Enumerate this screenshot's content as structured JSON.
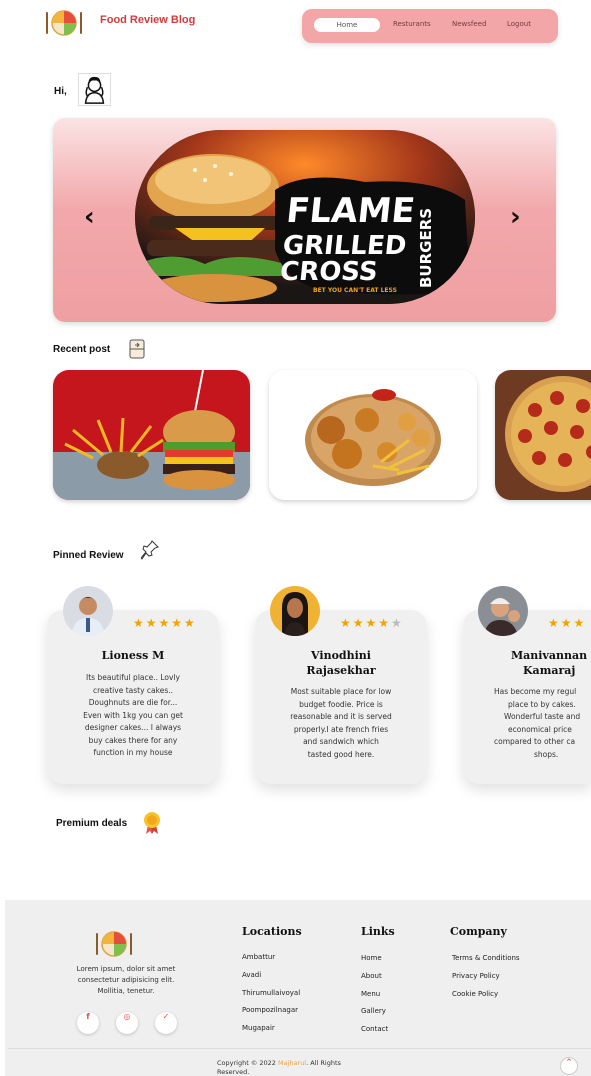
{
  "header": {
    "brand": "Food Review Blog",
    "nav": [
      {
        "label": "Home",
        "active": true
      },
      {
        "label": "Resturants"
      },
      {
        "label": "Newsfeed"
      },
      {
        "label": "Logout"
      }
    ]
  },
  "greeting": {
    "text": "Hi,"
  },
  "carousel": {
    "prev_icon": "chevron-left-icon",
    "next_icon": "chevron-right-icon",
    "slide": {
      "line1": "FLAME",
      "line2": "GRILLED",
      "line3": "CROSS",
      "vertical": "BURGERS",
      "tagline": "BET YOU CAN'T EAT LESS"
    }
  },
  "sections": {
    "recent_post": "Recent post",
    "pinned_review": "Pinned Review",
    "premium_deals": "Premium deals"
  },
  "reviews": [
    {
      "name": "Lioness M",
      "rating": 5,
      "text": [
        "Its beautiful place.. Lovly",
        "creative tasty cakes..",
        "Doughnuts are die for...",
        "Even with 1kg you can get",
        "designer cakes... I always",
        "buy cakes there for any",
        "function in my house"
      ]
    },
    {
      "name_lines": [
        "Vinodhini",
        "Rajasekhar"
      ],
      "rating": 4,
      "text": [
        "Most suitable place for low",
        "budget foodie. Price is",
        "reasonable and it is served",
        "properly.I ate french fries",
        "and sandwich which",
        "tasted good here."
      ]
    },
    {
      "name_lines": [
        "Manivannan",
        "Kamaraj"
      ],
      "rating": 3,
      "text": [
        "Has become my regul",
        "place to by cakes.",
        "Wonderful taste and",
        "economical price",
        "compared to other ca",
        "shops."
      ]
    }
  ],
  "footer": {
    "description": [
      "Lorem ipsum, dolor sit amet",
      "consectetur adipisicing elit.",
      "Mollitia, tenetur."
    ],
    "social": [
      {
        "icon": "facebook-icon",
        "glyph": "f"
      },
      {
        "icon": "instagram-icon",
        "glyph": "◎"
      },
      {
        "icon": "twitter-icon",
        "glyph": "✓"
      }
    ],
    "columns": {
      "locations": {
        "title": "Locations",
        "items": [
          "Ambattur",
          "Avadi",
          "Thirumullaivoyal",
          "Poompozilnagar",
          "Mugapair"
        ]
      },
      "links": {
        "title": "Links",
        "items": [
          "Home",
          "About",
          "Menu",
          "Gallery",
          "Contact"
        ]
      },
      "company": {
        "title": "Company",
        "items": [
          "Terms & Conditions",
          "Privacy Policy",
          "Cookie Policy"
        ]
      }
    },
    "copyright_prefix": "Copyright © 2022 ",
    "copyright_brand": "Majharul",
    "copyright_suffix": ". All Rights Reserved.",
    "scroll_top_icon": "chevron-up-icon"
  },
  "colors": {
    "brand": "#d23b3b",
    "nav_bg": "#f3a6a8",
    "star": "#f2a300",
    "card_bg": "#f0f0f0"
  }
}
